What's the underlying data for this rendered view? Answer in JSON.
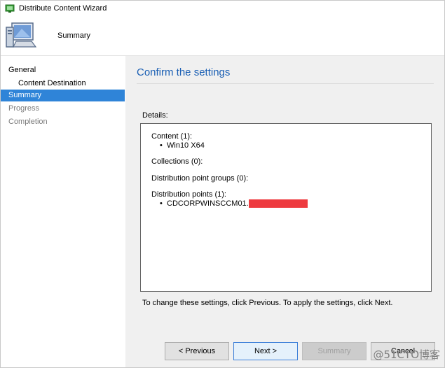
{
  "window": {
    "title": "Distribute Content Wizard"
  },
  "header": {
    "title": "Summary"
  },
  "sidebar": {
    "items": [
      {
        "label": "General",
        "state": "normal"
      },
      {
        "label": "Content Destination",
        "state": "normal"
      },
      {
        "label": "Summary",
        "state": "active"
      },
      {
        "label": "Progress",
        "state": "disabled"
      },
      {
        "label": "Completion",
        "state": "disabled"
      }
    ]
  },
  "main": {
    "heading": "Confirm the settings",
    "details_label": "Details:",
    "details": {
      "content_heading": "Content (1):",
      "content_item": "Win10 X64",
      "collections_heading": "Collections (0):",
      "dp_groups_heading": "Distribution point groups (0):",
      "dp_heading": "Distribution points (1):",
      "dp_item": "CDCORPWINSCCM01."
    },
    "footnote": "To change these settings, click Previous. To apply the settings, click Next."
  },
  "buttons": {
    "previous": "< Previous",
    "next": "Next >",
    "summary": "Summary",
    "cancel": "Cancel"
  },
  "watermark": "@51CTO博客",
  "colors": {
    "accent": "#2f84d8",
    "heading": "#1a5fb4",
    "redaction": "#ee3a3f"
  }
}
